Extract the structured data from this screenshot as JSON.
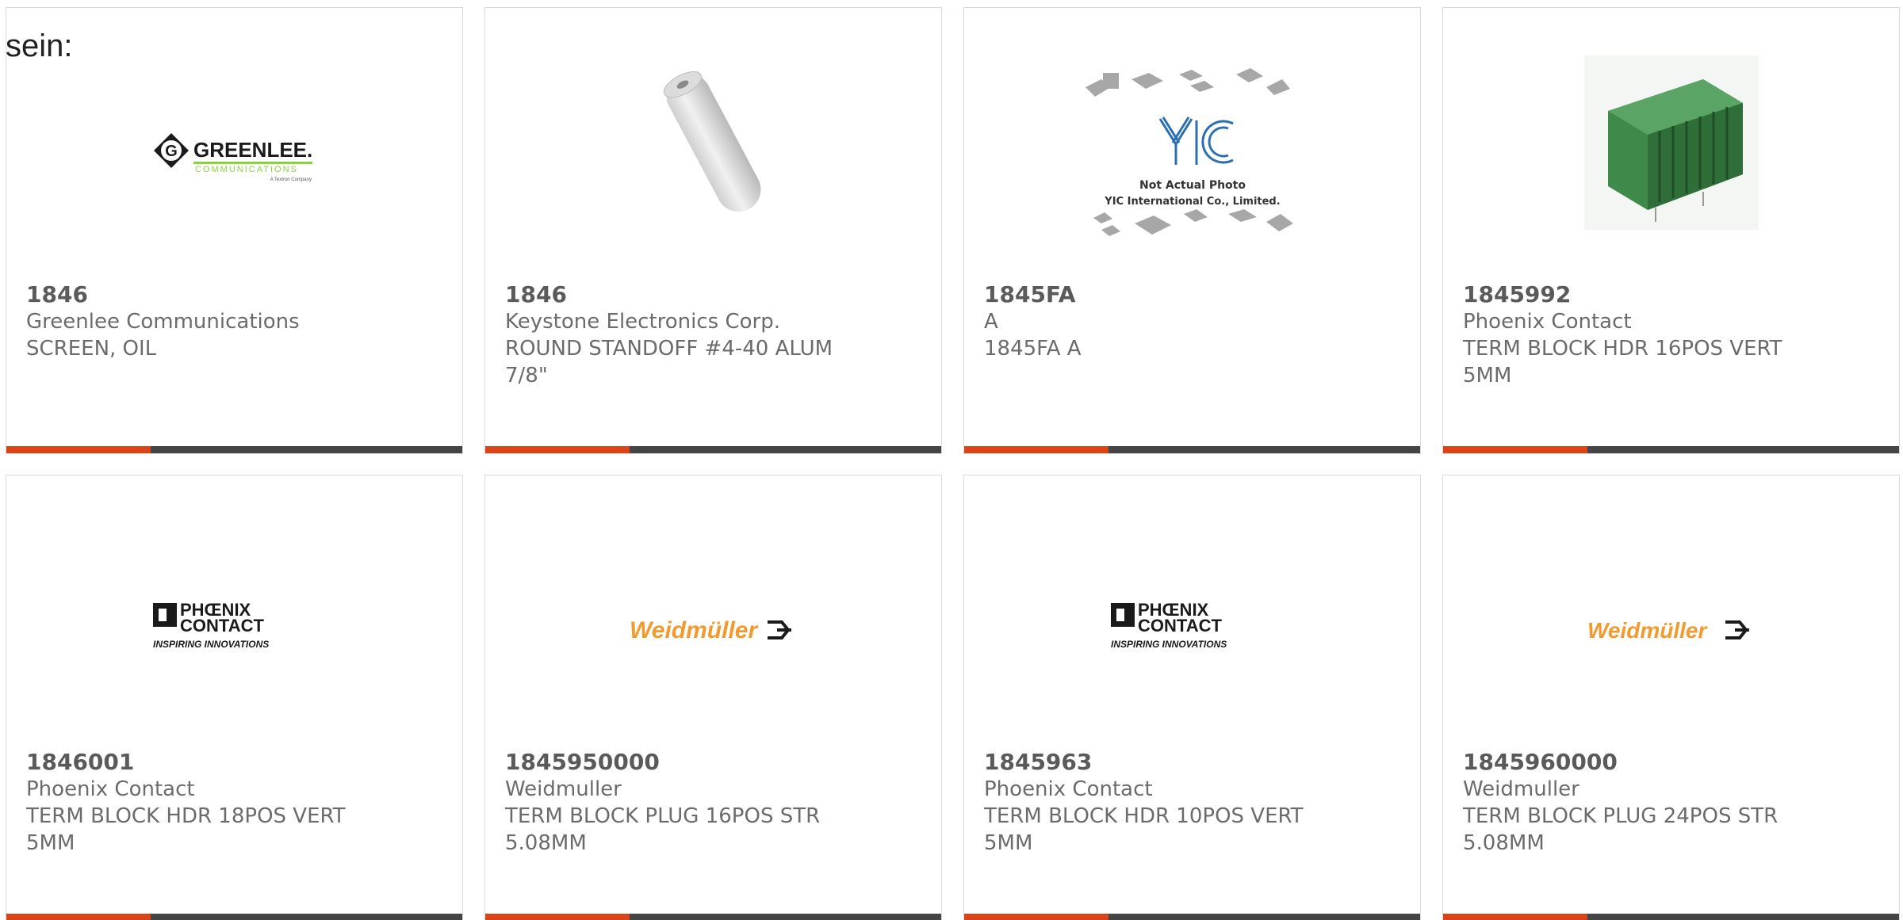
{
  "heading": "sein:",
  "colors": {
    "accent": "#d94418",
    "bar": "#454545",
    "weidmuller": "#f29a2e",
    "greenlee_green": "#8bd23f",
    "phoenix_green": "#3f8a4a"
  },
  "cards": [
    {
      "part": "1846",
      "manufacturer": "Greenlee Communications",
      "description": [
        "SCREEN, OIL"
      ],
      "image": "greenlee-logo",
      "logo": {
        "name": "GREENLEE.",
        "sub": "COMMUNICATIONS",
        "tag": "A Textron Company"
      }
    },
    {
      "part": "1846",
      "manufacturer": "Keystone Electronics Corp.",
      "description": [
        "ROUND STANDOFF #4-40 ALUM",
        "7/8\""
      ],
      "image": "standoff-photo"
    },
    {
      "part": "1845FA",
      "manufacturer": "A",
      "description": [
        "1845FA A"
      ],
      "image": "yic-placeholder",
      "logo": {
        "name": "YIC",
        "line1": "Not Actual Photo",
        "line2": "YIC International Co., Limited."
      }
    },
    {
      "part": "1845992",
      "manufacturer": "Phoenix Contact",
      "description": [
        "TERM BLOCK HDR 16POS VERT",
        "5MM"
      ],
      "image": "terminal-block-photo"
    },
    {
      "part": "1846001",
      "manufacturer": "Phoenix Contact",
      "description": [
        "TERM BLOCK HDR 18POS VERT",
        "5MM"
      ],
      "image": "phoenix-logo",
      "logo": {
        "name1": "PHŒNIX",
        "name2": "CONTACT",
        "tag": "INSPIRING INNOVATIONS"
      }
    },
    {
      "part": "1845950000",
      "manufacturer": "Weidmuller",
      "description": [
        "TERM BLOCK PLUG 16POS STR",
        "5.08MM"
      ],
      "image": "weidmuller-logo",
      "logo": {
        "name": "Weidmüller"
      }
    },
    {
      "part": "1845963",
      "manufacturer": "Phoenix Contact",
      "description": [
        "TERM BLOCK HDR 10POS VERT",
        "5MM"
      ],
      "image": "phoenix-logo",
      "logo": {
        "name1": "PHŒNIX",
        "name2": "CONTACT",
        "tag": "INSPIRING INNOVATIONS"
      }
    },
    {
      "part": "1845960000",
      "manufacturer": "Weidmuller",
      "description": [
        "TERM BLOCK PLUG 24POS STR",
        "5.08MM"
      ],
      "image": "weidmuller-logo",
      "logo": {
        "name": "Weidmüller"
      }
    }
  ]
}
